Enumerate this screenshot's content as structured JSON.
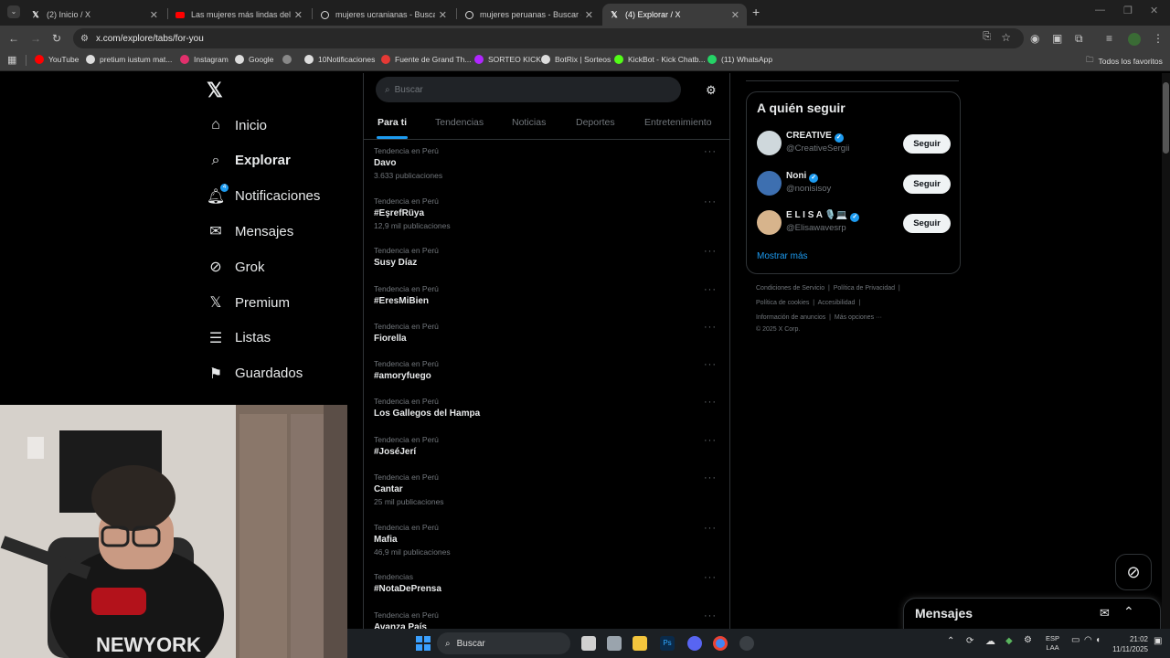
{
  "browser": {
    "tabs": [
      {
        "icon": "x-logo-icon",
        "title": "(2) Inicio / X",
        "active": false
      },
      {
        "icon": "youtube-icon",
        "title": "Las mujeres más lindas del plan",
        "active": false
      },
      {
        "icon": "google-icon",
        "title": "mujeres ucranianas - Buscar co",
        "active": false
      },
      {
        "icon": "google-icon",
        "title": "mujeres peruanas - Buscar con",
        "active": false
      },
      {
        "icon": "x-logo-icon",
        "title": "(4) Explorar / X",
        "active": true
      }
    ],
    "url": "x.com/explore/tabs/for-you",
    "bookmarks": [
      {
        "label": "YouTube",
        "color": "#ff0000"
      },
      {
        "label": "pretium iustum mat...",
        "color": "#dddddd"
      },
      {
        "label": "Instagram",
        "color": "#e1306c"
      },
      {
        "label": "Google",
        "color": "#dddddd"
      },
      {
        "label": "",
        "color": "#888888"
      },
      {
        "label": "10Notificaciones",
        "color": "#dddddd"
      },
      {
        "label": "Fuente de Grand Th...",
        "color": "#e53935"
      },
      {
        "label": "SORTEO KICK",
        "color": "#b026ff"
      },
      {
        "label": "BotRix | Sorteos",
        "color": "#dddddd"
      },
      {
        "label": "KickBot - Kick Chatb...",
        "color": "#53fc18"
      },
      {
        "label": "(11) WhatsApp",
        "color": "#25d366"
      }
    ],
    "all_bookmarks": "Todos los favoritos"
  },
  "x": {
    "nav": [
      {
        "label": "Inicio",
        "icon": "home-icon"
      },
      {
        "label": "Explorar",
        "icon": "search-icon",
        "active": true
      },
      {
        "label": "Notificaciones",
        "icon": "bell-icon",
        "badge": "4"
      },
      {
        "label": "Mensajes",
        "icon": "mail-icon"
      },
      {
        "label": "Grok",
        "icon": "grok-icon"
      },
      {
        "label": "Premium",
        "icon": "x-logo-icon"
      },
      {
        "label": "Listas",
        "icon": "list-icon"
      },
      {
        "label": "Guardados",
        "icon": "bookmark-icon"
      }
    ],
    "search_placeholder": "Buscar",
    "explore_tabs": [
      "Para ti",
      "Tendencias",
      "Noticias",
      "Deportes",
      "Entretenimiento"
    ],
    "trends": [
      {
        "category": "Tendencia en Perú",
        "name": "Davo",
        "count": "3.633 publicaciones"
      },
      {
        "category": "Tendencia en Perú",
        "name": "#EşrefRüya",
        "count": "12,9 mil publicaciones"
      },
      {
        "category": "Tendencia en Perú",
        "name": "Susy Díaz",
        "count": ""
      },
      {
        "category": "Tendencia en Perú",
        "name": "#EresMiBien",
        "count": ""
      },
      {
        "category": "Tendencia en Perú",
        "name": "Fiorella",
        "count": ""
      },
      {
        "category": "Tendencia en Perú",
        "name": "#amoryfuego",
        "count": ""
      },
      {
        "category": "Tendencia en Perú",
        "name": "Los Gallegos del Hampa",
        "count": ""
      },
      {
        "category": "Tendencia en Perú",
        "name": "#JoséJerí",
        "count": ""
      },
      {
        "category": "Tendencia en Perú",
        "name": "Cantar",
        "count": "25 mil publicaciones"
      },
      {
        "category": "Tendencia en Perú",
        "name": "Mafia",
        "count": "46,9 mil publicaciones"
      },
      {
        "category": "Tendencias",
        "name": "#NotaDePrensa",
        "count": ""
      },
      {
        "category": "Tendencia en Perú",
        "name": "Avanza País",
        "count": ""
      }
    ],
    "who_to_follow": {
      "title": "A quién seguir",
      "users": [
        {
          "name": "CREATIVE",
          "handle": "@CreativeSergii",
          "button": "Seguir",
          "avatar_color": "#cfd8dc"
        },
        {
          "name": "Noni",
          "handle": "@nonisisoy",
          "button": "Seguir",
          "avatar_color": "#3d6fb0"
        },
        {
          "name": "E L I S A 🎙️💻",
          "handle": "@Elisawavesrp",
          "button": "Seguir",
          "avatar_color": "#d7b48c"
        }
      ],
      "show_more": "Mostrar más"
    },
    "footer": {
      "line1": [
        "Condiciones de Servicio",
        "Política de Privacidad"
      ],
      "line2": [
        "Política de cookies",
        "Accesibilidad"
      ],
      "line3": [
        "Información de anuncios",
        "Más opciones ···"
      ],
      "copyright": "© 2025 X Corp."
    },
    "messages_title": "Mensajes"
  },
  "taskbar": {
    "search": "Buscar",
    "lang": "ESP",
    "lang2": "LAA",
    "time": "21:02",
    "date": "11/11/2025"
  }
}
